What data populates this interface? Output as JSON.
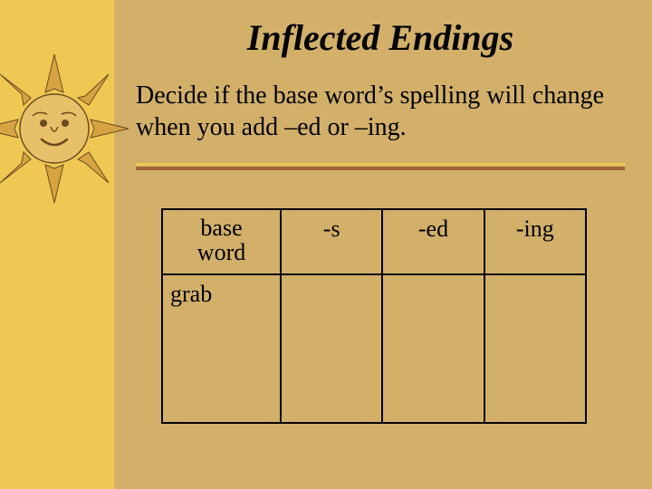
{
  "slide": {
    "title": "Inflected Endings",
    "subtitle": "Decide if the base word’s spelling will change when you add –ed or –ing."
  },
  "table": {
    "headers": {
      "base_word_line1": "base",
      "base_word_line2": "word",
      "col_s": "-s",
      "col_ed": "-ed",
      "col_ing": "-ing"
    },
    "rows": [
      {
        "base_word": "grab",
        "s": "",
        "ed": "",
        "ing": ""
      }
    ]
  },
  "decor": {
    "sun_name": "sun-face-icon"
  }
}
